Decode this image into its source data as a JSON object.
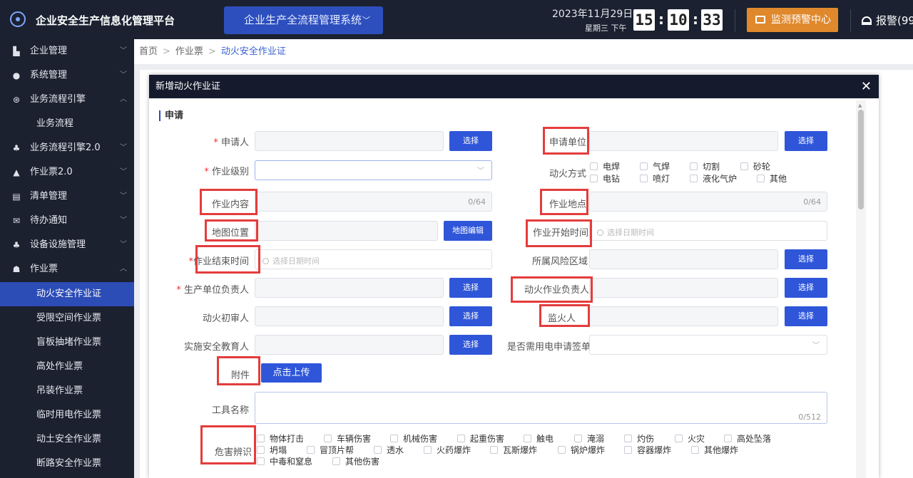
{
  "header": {
    "app_title": "企业安全生产信息化管理平台",
    "system_select": "企业生产全流程管理系统",
    "date": "2023年11月29日",
    "weekday": "星期三 下午",
    "clock": {
      "h": "15",
      "m": "10",
      "s": "33"
    },
    "monitor_btn": "监测预警中心",
    "alarm": "报警(99"
  },
  "sidebar": {
    "items": [
      {
        "label": "企业管理",
        "icon": "building-icon"
      },
      {
        "label": "系统管理",
        "icon": "gear-icon"
      },
      {
        "label": "业务流程引擎",
        "icon": "flow-icon"
      },
      {
        "label": "业务流程",
        "icon": ""
      },
      {
        "label": "业务流程引擎2.0",
        "icon": "flow-icon"
      },
      {
        "label": "作业票2.0",
        "icon": "ticket-icon"
      },
      {
        "label": "清单管理",
        "icon": "list-icon"
      },
      {
        "label": "待办通知",
        "icon": "mail-icon"
      },
      {
        "label": "设备设施管理",
        "icon": "device-icon"
      },
      {
        "label": "作业票",
        "icon": "ticket-icon"
      },
      {
        "label": "动火安全作业证",
        "icon": ""
      },
      {
        "label": "受限空间作业票",
        "icon": ""
      },
      {
        "label": "盲板抽堵作业票",
        "icon": ""
      },
      {
        "label": "高处作业票",
        "icon": ""
      },
      {
        "label": "吊装作业票",
        "icon": ""
      },
      {
        "label": "临时用电作业票",
        "icon": ""
      },
      {
        "label": "动土安全作业票",
        "icon": ""
      },
      {
        "label": "断路安全作业票",
        "icon": ""
      }
    ]
  },
  "breadcrumb": [
    "首页",
    "作业票",
    "动火安全作业证"
  ],
  "modal": {
    "title": "新增动火作业证",
    "section": "申请",
    "labels": {
      "applicant": "申请人",
      "apply_unit": "申请单位",
      "work_level": "作业级别",
      "fire_method": "动火方式",
      "work_content": "作业内容",
      "work_location": "作业地点",
      "map_position": "地图位置",
      "start_time": "作业开始时间",
      "end_time": "作业结束时间",
      "risk_area": "所属风险区域",
      "prod_leader": "生产单位负责人",
      "fire_leader": "动火作业负责人",
      "fire_reviewer": "动火初审人",
      "fire_watcher": "监火人",
      "safety_educator": "实施安全教育人",
      "need_power": "是否需用电申请签单",
      "attachment": "附件",
      "tool_name": "工具名称",
      "hazard": "危害辨识"
    },
    "select_btn": "选择",
    "map_edit_btn": "地图编辑",
    "upload_btn": "点击上传",
    "counter_64": "0/64",
    "counter_512": "0/512",
    "date_placeholder": "选择日期时间",
    "fire_methods": [
      "电焊",
      "气焊",
      "切割",
      "砂轮",
      "电钻",
      "喷灯",
      "液化气炉",
      "其他"
    ],
    "hazards": [
      "物体打击",
      "车辆伤害",
      "机械伤害",
      "起重伤害",
      "触电",
      "淹溺",
      "灼伤",
      "火灾",
      "高处坠落",
      "坍塌",
      "冒顶片帮",
      "透水",
      "火药爆炸",
      "瓦斯爆炸",
      "锅炉爆炸",
      "容器爆炸",
      "其他爆炸",
      "中毒和窒息",
      "其他伤害"
    ]
  },
  "colors": {
    "accent": "#2f56d9",
    "highlight": "#e43c3c",
    "header_bg": "#1b2130",
    "orange": "#e0892c"
  }
}
